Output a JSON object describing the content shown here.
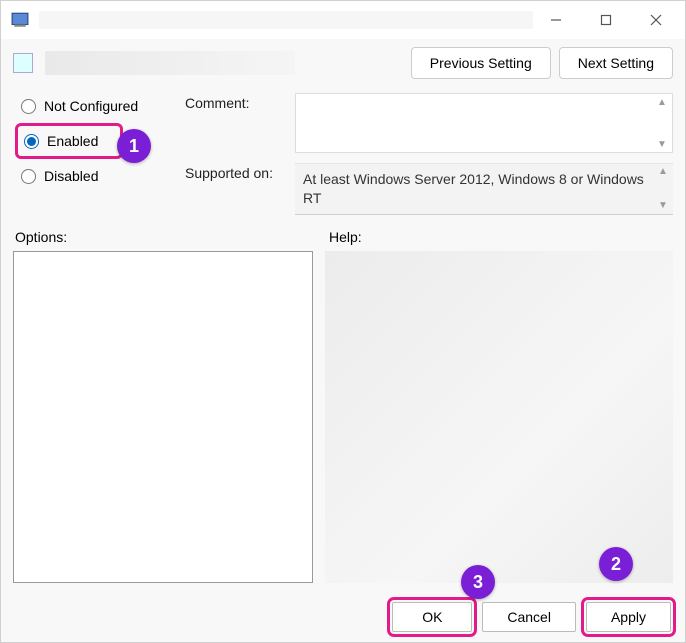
{
  "titlebar": {
    "title": ""
  },
  "nav": {
    "prev": "Previous Setting",
    "next": "Next Setting"
  },
  "radios": {
    "not_configured": "Not Configured",
    "enabled": "Enabled",
    "disabled": "Disabled",
    "selected": "enabled"
  },
  "labels": {
    "comment": "Comment:",
    "supported_on": "Supported on:",
    "options": "Options:",
    "help": "Help:"
  },
  "supported_text": "At least Windows Server 2012, Windows 8 or Windows RT",
  "footer": {
    "ok": "OK",
    "cancel": "Cancel",
    "apply": "Apply"
  },
  "annotations": {
    "one": "1",
    "two": "2",
    "three": "3"
  }
}
